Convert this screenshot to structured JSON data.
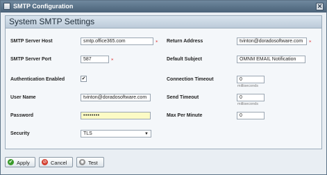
{
  "window": {
    "title": "SMTP Configuration",
    "close_glyph": "✕"
  },
  "panel": {
    "title": "System SMTP Settings"
  },
  "form": {
    "host": {
      "label": "SMTP Server Host",
      "value": "smtp.office365.com"
    },
    "port": {
      "label": "SMTP Server Port",
      "value": "587"
    },
    "auth": {
      "label": "Authentication Enabled",
      "checked": true,
      "glyph": "✔"
    },
    "user": {
      "label": "User Name",
      "value": "tvinton@doradosoftware.com"
    },
    "password": {
      "label": "Password",
      "value": "••••••••"
    },
    "security": {
      "label": "Security",
      "value": "TLS",
      "arrow": "▼"
    },
    "return_address": {
      "label": "Return Address",
      "value": "tvinton@doradosoftware.com"
    },
    "default_subject": {
      "label": "Default Subject",
      "value": "OMNM EMAIL Notification"
    },
    "connection_timeout": {
      "label": "Connection Timeout",
      "value": "0",
      "unit": "milliseconds"
    },
    "send_timeout": {
      "label": "Send Timeout",
      "value": "0",
      "unit": "milliseconds"
    },
    "max_per_minute": {
      "label": "Max Per Minute",
      "value": "0"
    }
  },
  "buttons": {
    "apply": {
      "label": "Apply",
      "icon": "check-icon",
      "color": "#3a9a2a"
    },
    "cancel": {
      "label": "Cancel",
      "icon": "cancel-icon",
      "color": "#d23a2a"
    },
    "test": {
      "label": "Test",
      "icon": "test-icon",
      "color": "#8a8a8a"
    }
  },
  "colors": {
    "titlebar": "#5a7288",
    "required_marker": "#d33333",
    "password_bg": "#fcfbc5"
  }
}
